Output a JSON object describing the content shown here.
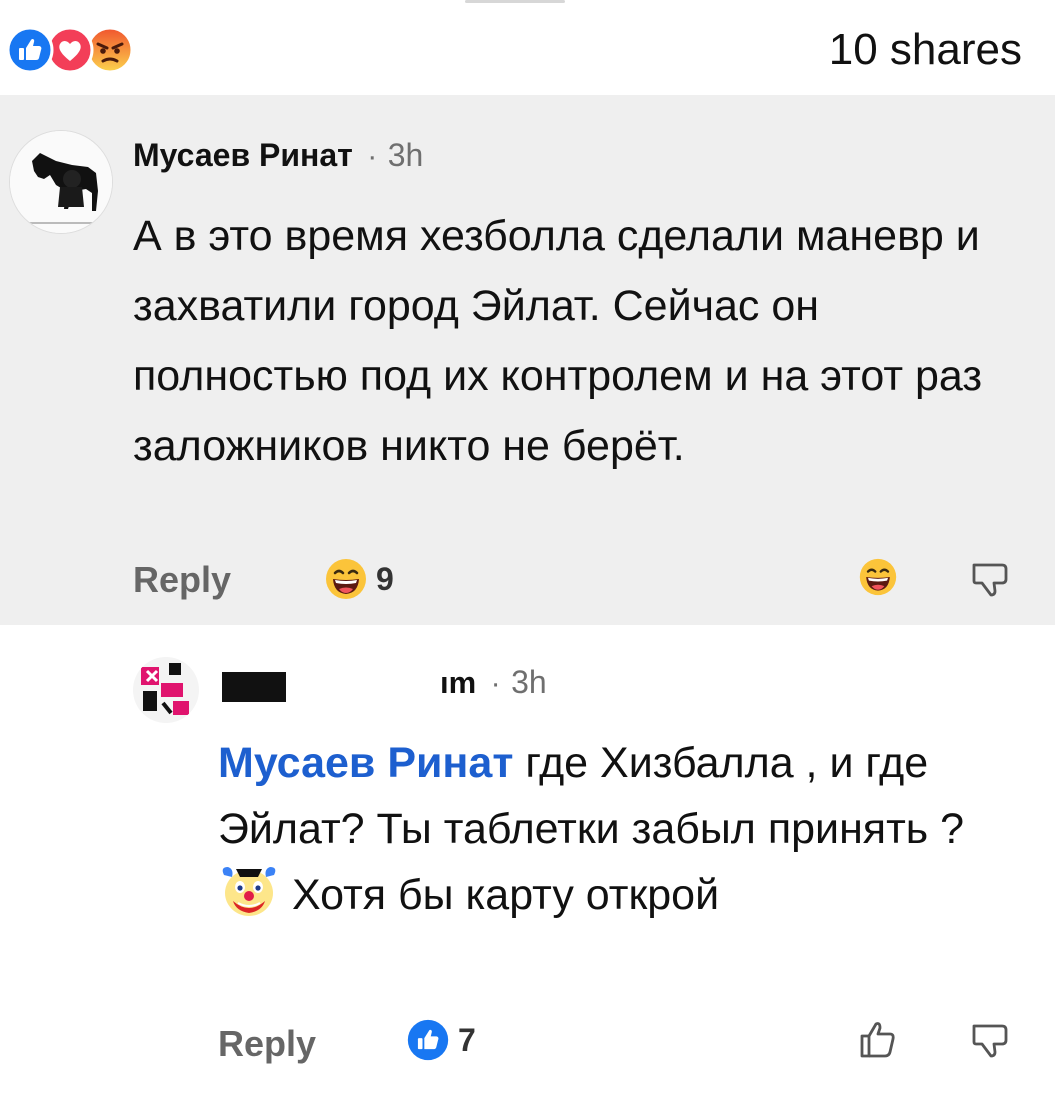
{
  "header": {
    "shares_label": "10 shares",
    "reaction_icons": [
      "like-reaction",
      "love-reaction",
      "angry-reaction"
    ]
  },
  "comments": [
    {
      "author": "Мусаев Ринат",
      "separator": "·",
      "time": "3h",
      "text": "А в это время хезболла сделали маневр и захватили город Эйлат. Сейчас он полностью под их контролем и на этот раз заложников никто не берёт.",
      "reply_label": "Reply",
      "reaction_count": "9",
      "reaction_icon": "laughing-face-icon"
    },
    {
      "author_visible_fragment": "ım",
      "separator": "·",
      "time": "3h",
      "mention": "Мусаев Ринат",
      "text_part1": " где Хизбалла , и где Эйлат? Ты таблетки забыл принять ? ",
      "inline_emoji": "clown-face-icon",
      "text_part2": " Хотя бы карту открой",
      "reply_label": "Reply",
      "reaction_count": "7",
      "reaction_icon": "like-reaction"
    }
  ],
  "colors": {
    "mention_blue": "#1d5fcf",
    "like_blue": "#1877f2",
    "love_red": "#f33e58",
    "highlight_bg": "#efefef"
  }
}
